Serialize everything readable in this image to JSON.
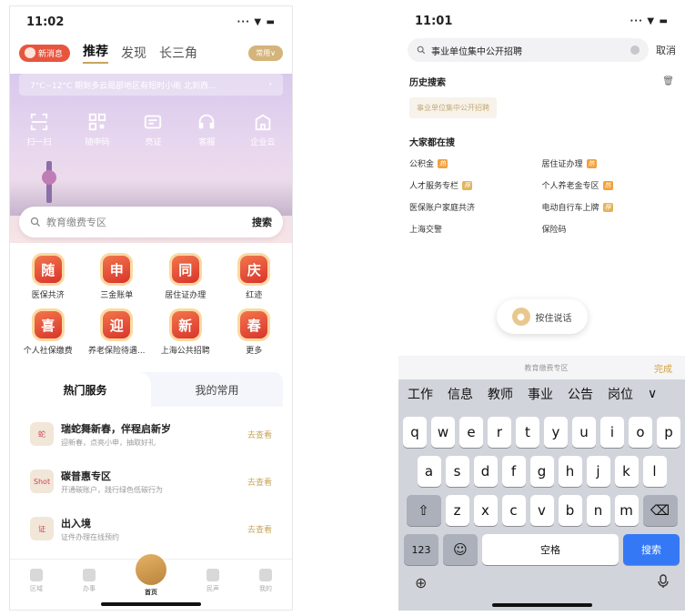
{
  "left": {
    "status": {
      "time": "11:02",
      "icons": "∙∙∙ ▼ ▬"
    },
    "nav": {
      "msg": "新消息",
      "tabs": [
        "推荐",
        "发现",
        "长三角"
      ],
      "lang": "常用∨"
    },
    "weather": "7°C~12°C 期到多云局部地区有短时小雨 北到西...",
    "weather_arrow": "›",
    "quick": [
      "扫一扫",
      "随申码",
      "亮证",
      "客服",
      "企业云"
    ],
    "search": {
      "placeholder": "教育缴费专区",
      "button": "搜索"
    },
    "grid": [
      {
        "icon": "随",
        "label": "医保共济"
      },
      {
        "icon": "申",
        "label": "三金账单"
      },
      {
        "icon": "同",
        "label": "居住证办理"
      },
      {
        "icon": "庆",
        "label": "红迹"
      },
      {
        "icon": "喜",
        "label": "个人社保缴费"
      },
      {
        "icon": "迎",
        "label": "养老保险待遇..."
      },
      {
        "icon": "新",
        "label": "上海公共招聘"
      },
      {
        "icon": "春",
        "label": "更多"
      }
    ],
    "panel": {
      "tabs": [
        "热门服务",
        "我的常用"
      ],
      "items": [
        {
          "icon": "蛇",
          "title": "瑞蛇舞新春，伴程启新岁",
          "sub": "迎新春，点亮小申，抽取好礼",
          "go": "去查看"
        },
        {
          "icon": "Shot",
          "title": "碳普惠专区",
          "sub": "开通碳账户，践行绿色低碳行为",
          "go": "去查看"
        },
        {
          "icon": "证",
          "title": "出入境",
          "sub": "证件办理在线预约",
          "go": "去查看"
        }
      ]
    },
    "bottomnav": [
      "区域",
      "办事",
      "首页",
      "民声",
      "我的"
    ]
  },
  "right": {
    "status": {
      "time": "11:01",
      "icons": "∙∙∙ ▼ ▬"
    },
    "search": {
      "value": "事业单位集中公开招聘",
      "cancel": "取消"
    },
    "history": {
      "title": "历史搜索",
      "items": [
        "事业单位集中公开招聘"
      ]
    },
    "hot": {
      "title": "大家都在搜",
      "items": [
        {
          "label": "公积金",
          "tag": "热",
          "type": "h"
        },
        {
          "label": "居住证办理",
          "tag": "热",
          "type": "h"
        },
        {
          "label": "人才服务专栏",
          "tag": "荐",
          "type": "n"
        },
        {
          "label": "个人养老金专区",
          "tag": "热",
          "type": "h"
        },
        {
          "label": "医保账户家庭共济",
          "tag": "",
          "type": ""
        },
        {
          "label": "电动自行车上牌",
          "tag": "荐",
          "type": "n"
        },
        {
          "label": "上海交警",
          "tag": "",
          "type": ""
        },
        {
          "label": "保险码",
          "tag": "",
          "type": ""
        }
      ]
    },
    "voice": "按住说话",
    "keyboard": {
      "accessory": {
        "hint": "教育缴费专区",
        "done": "完成"
      },
      "candidates": [
        "工作",
        "信息",
        "教师",
        "事业",
        "公告",
        "岗位",
        "∨"
      ],
      "row1": [
        "q",
        "w",
        "e",
        "r",
        "t",
        "y",
        "u",
        "i",
        "o",
        "p"
      ],
      "row2": [
        "a",
        "s",
        "d",
        "f",
        "g",
        "h",
        "j",
        "k",
        "l"
      ],
      "row3": [
        "z",
        "x",
        "c",
        "v",
        "b",
        "n",
        "m"
      ],
      "shift": "⇧",
      "delete": "⌫",
      "num": "123",
      "emoji": "☺",
      "space": "空格",
      "search": "搜索",
      "globe": "⊕",
      "mic": "♂"
    }
  },
  "colors": {
    "accent": "#c9a45a",
    "badge": "#d9342b",
    "keyboard_search": "#3478f6"
  }
}
